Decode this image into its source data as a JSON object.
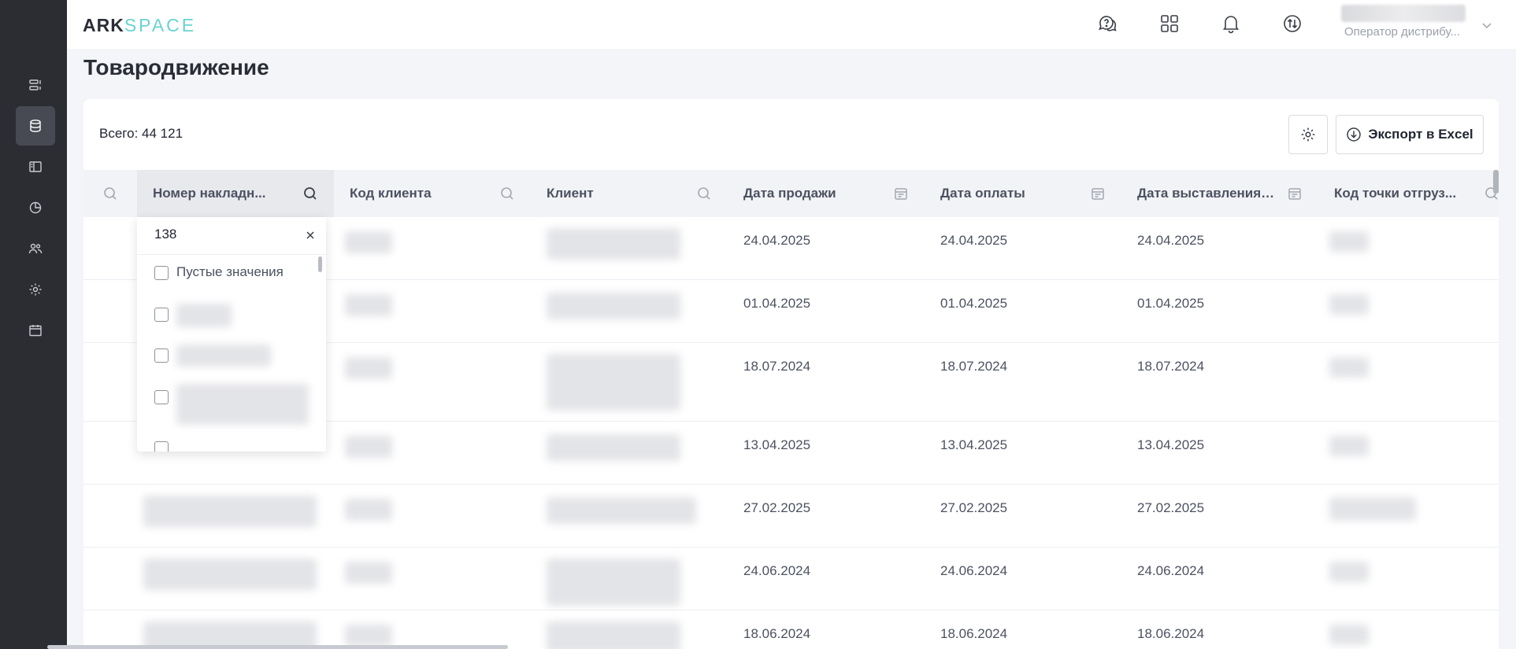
{
  "brand": {
    "logo_main": "ARK",
    "logo_accent": "SPACE"
  },
  "sidebar": {
    "items": [
      {
        "icon": "list-icon",
        "active": false
      },
      {
        "icon": "database-icon",
        "active": true
      },
      {
        "icon": "book-icon",
        "active": false
      },
      {
        "icon": "pie-chart-icon",
        "active": false
      },
      {
        "icon": "users-icon",
        "active": false
      },
      {
        "icon": "gear-icon",
        "active": false
      },
      {
        "icon": "calendar-icon",
        "active": false
      }
    ]
  },
  "header": {
    "icons": [
      "help-chat-icon",
      "apps-grid-icon",
      "bell-icon",
      "sync-icon"
    ],
    "user_role": "Оператор дистрибу..."
  },
  "page": {
    "title": "Товародвижение"
  },
  "toolbar": {
    "total": "Всего: 44 121",
    "export_label": "Экспорт в Excel"
  },
  "table": {
    "columns": [
      {
        "label": "Номер накладн...",
        "filter": "search"
      },
      {
        "label": "Код клиента",
        "filter": "search"
      },
      {
        "label": "Клиент",
        "filter": "search"
      },
      {
        "label": "Дата продажи",
        "filter": "date"
      },
      {
        "label": "Дата оплаты",
        "filter": "date"
      },
      {
        "label": "Дата выставления ...",
        "filter": "date"
      },
      {
        "label": "Код точки отгруз...",
        "filter": "search"
      }
    ],
    "rows": [
      {
        "sale": "24.04.2025",
        "pay": "24.04.2025",
        "issue": "24.04.2025"
      },
      {
        "sale": "01.04.2025",
        "pay": "01.04.2025",
        "issue": "01.04.2025"
      },
      {
        "sale": "18.07.2024",
        "pay": "18.07.2024",
        "issue": "18.07.2024"
      },
      {
        "sale": "13.04.2025",
        "pay": "13.04.2025",
        "issue": "13.04.2025"
      },
      {
        "sale": "27.02.2025",
        "pay": "27.02.2025",
        "issue": "27.02.2025"
      },
      {
        "sale": "24.06.2024",
        "pay": "24.06.2024",
        "issue": "24.06.2024"
      },
      {
        "sale": "18.06.2024",
        "pay": "18.06.2024",
        "issue": "18.06.2024"
      }
    ]
  },
  "filter": {
    "value": "138",
    "empty_label": "Пустые значения"
  },
  "colors": {
    "sidebar_bg": "#2b2d33",
    "accent": "#69d3d0",
    "header_bg": "#f2f3f6"
  }
}
